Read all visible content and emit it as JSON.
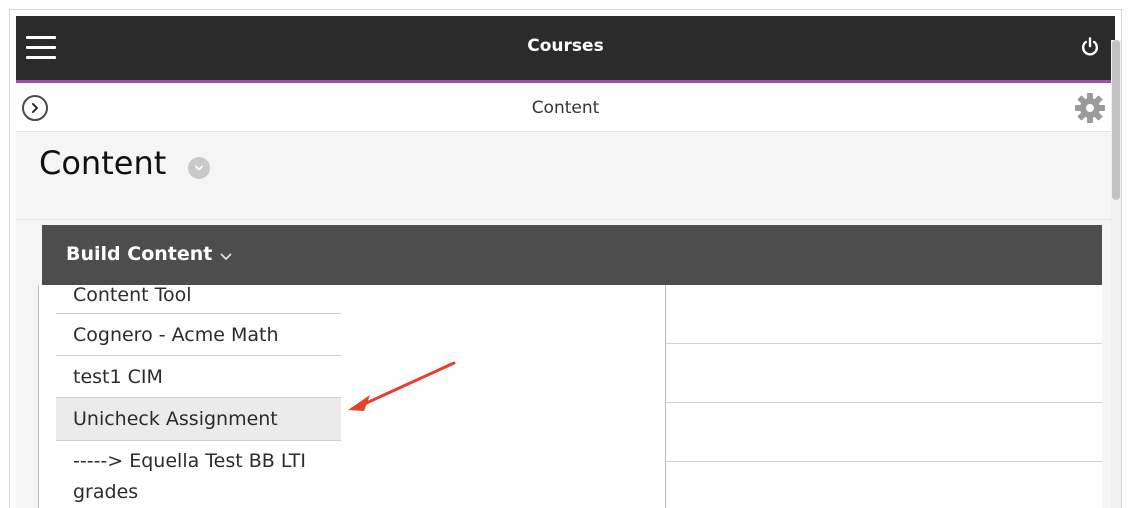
{
  "header": {
    "title": "Courses",
    "menu_icon": "hamburger-menu-icon",
    "power_icon": "power-icon",
    "accent_color": "#9b51a6",
    "bar_color": "#2b2b2b"
  },
  "subheader": {
    "title": "Content",
    "expand_icon": "chevron-right-circle-icon",
    "settings_icon": "gear-icon"
  },
  "page": {
    "heading": "Content",
    "heading_menu_icon": "chevron-down-circle-icon"
  },
  "build_content": {
    "label": "Build Content",
    "caret_icon": "chevron-down-icon",
    "bar_color": "#4d4d4d"
  },
  "menu": {
    "items": [
      {
        "label": "Content Tool"
      },
      {
        "label": "Cognero - Acme Math"
      },
      {
        "label": "test1 CIM"
      },
      {
        "label": "Unicheck Assignment",
        "highlighted": true
      },
      {
        "label": "-----> Equella Test BB LTI grades"
      }
    ]
  },
  "annotation": {
    "arrow_color": "#e8412b"
  }
}
